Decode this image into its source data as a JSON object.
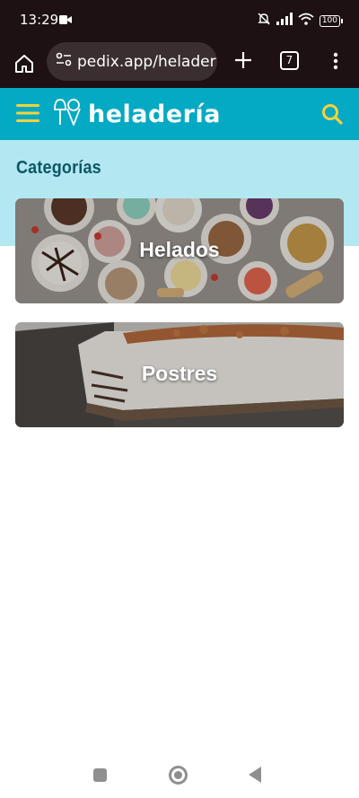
{
  "status_bar": {
    "time": "13:29",
    "battery": "100",
    "icons": [
      "video-icon",
      "mute-icon",
      "signal-icon",
      "wifi-icon",
      "battery-icon"
    ]
  },
  "browser": {
    "url": "pedix.app/heladeriac",
    "tab_count": "7"
  },
  "app_header": {
    "logo_text": "heladería",
    "colors": {
      "header": "#04a9c3",
      "accent": "#f6d23c"
    }
  },
  "categories": {
    "title": "Categorías",
    "items": [
      {
        "label": "Helados"
      },
      {
        "label": "Postres"
      }
    ]
  }
}
